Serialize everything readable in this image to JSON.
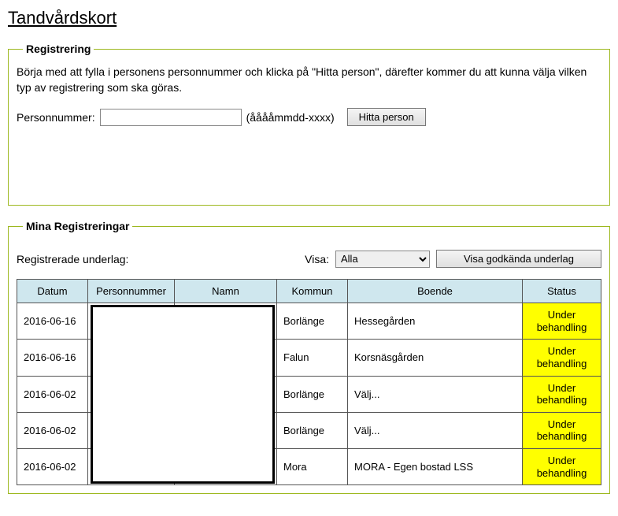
{
  "page_title": "Tandvårdskort",
  "registration": {
    "legend": "Registrering",
    "intro": "Börja med att fylla i personens personnummer och klicka på \"Hitta person\", därefter kommer du att kunna välja vilken typ av registrering som ska göras.",
    "label": "Personnummer:",
    "input_value": "",
    "hint": "(ååååmmdd-xxxx)",
    "button": "Hitta person"
  },
  "mine": {
    "legend": "Mina Registreringar",
    "subtitle": "Registrerade underlag:",
    "visa_label": "Visa:",
    "visa_value": "Alla",
    "approved_button": "Visa godkända underlag",
    "columns": [
      "Datum",
      "Personnummer",
      "Namn",
      "Kommun",
      "Boende",
      "Status"
    ],
    "rows": [
      {
        "datum": "2016-06-16",
        "pnr": "",
        "namn": "",
        "kommun": "Borlänge",
        "boende": "Hessegården",
        "status": "Under behandling"
      },
      {
        "datum": "2016-06-16",
        "pnr": "",
        "namn": "",
        "kommun": "Falun",
        "boende": "Korsnäsgården",
        "status": "Under behandling"
      },
      {
        "datum": "2016-06-02",
        "pnr": "",
        "namn": "",
        "kommun": "Borlänge",
        "boende": "Välj...",
        "status": "Under behandling"
      },
      {
        "datum": "2016-06-02",
        "pnr": "",
        "namn": "",
        "kommun": "Borlänge",
        "boende": "Välj...",
        "status": "Under behandling"
      },
      {
        "datum": "2016-06-02",
        "pnr": "",
        "namn": "",
        "kommun": "Mora",
        "boende": "MORA - Egen bostad LSS",
        "status": "Under behandling"
      }
    ]
  }
}
